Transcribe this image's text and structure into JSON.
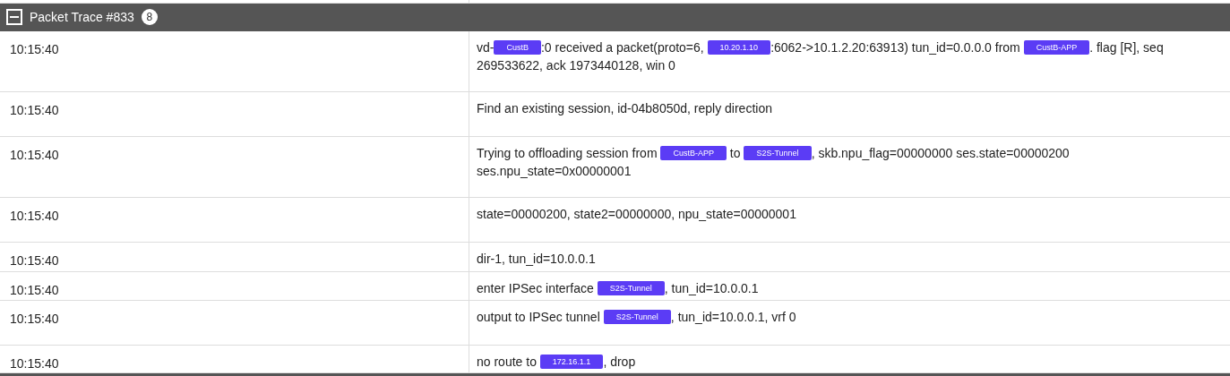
{
  "panel": {
    "title": "Packet Trace #833",
    "count": "8",
    "expanded": true
  },
  "rows": [
    {
      "time": "10:15:40",
      "message": [
        {
          "kind": "text",
          "text": "vd-"
        },
        {
          "kind": "tag",
          "text": "CustB"
        },
        {
          "kind": "text",
          "text": ":0 received a packet(proto=6, "
        },
        {
          "kind": "tag",
          "text": "10.20.1.10"
        },
        {
          "kind": "text",
          "text": ":6062->10.1.2.20:63913) tun_id=0.0.0.0 from "
        },
        {
          "kind": "tag",
          "text": "CustB-APP"
        },
        {
          "kind": "text",
          "text": ". flag [R], seq 269533622, ack 1973440128, win 0"
        }
      ]
    },
    {
      "time": "10:15:40",
      "message": [
        {
          "kind": "text",
          "text": "Find an existing session, id-04b8050d, reply direction"
        }
      ]
    },
    {
      "time": "10:15:40",
      "message": [
        {
          "kind": "text",
          "text": "Trying to offloading session from "
        },
        {
          "kind": "tag",
          "text": "CustB-APP"
        },
        {
          "kind": "text",
          "text": " to "
        },
        {
          "kind": "tag",
          "text": "S2S-Tunnel"
        },
        {
          "kind": "text",
          "text": ", skb.npu_flag=00000000 ses.state=00000200 ses.npu_state=0x00000001"
        }
      ]
    },
    {
      "time": "10:15:40",
      "message": [
        {
          "kind": "text",
          "text": "state=00000200, state2=00000000, npu_state=00000001"
        }
      ]
    },
    {
      "time": "10:15:40",
      "message": [
        {
          "kind": "text",
          "text": "dir-1, tun_id=10.0.0.1"
        }
      ]
    },
    {
      "time": "10:15:40",
      "message": [
        {
          "kind": "text",
          "text": "enter IPSec interface "
        },
        {
          "kind": "tag",
          "text": "S2S-Tunnel"
        },
        {
          "kind": "text",
          "text": ", tun_id=10.0.0.1"
        }
      ]
    },
    {
      "time": "10:15:40",
      "message": [
        {
          "kind": "text",
          "text": "output to IPSec tunnel "
        },
        {
          "kind": "tag",
          "text": "S2S-Tunnel"
        },
        {
          "kind": "text",
          "text": ", tun_id=10.0.0.1, vrf 0"
        }
      ]
    },
    {
      "time": "10:15:40",
      "message": [
        {
          "kind": "text",
          "text": "no route to "
        },
        {
          "kind": "tag",
          "text": "172.16.1.1"
        },
        {
          "kind": "text",
          "text": ", drop"
        }
      ]
    }
  ]
}
